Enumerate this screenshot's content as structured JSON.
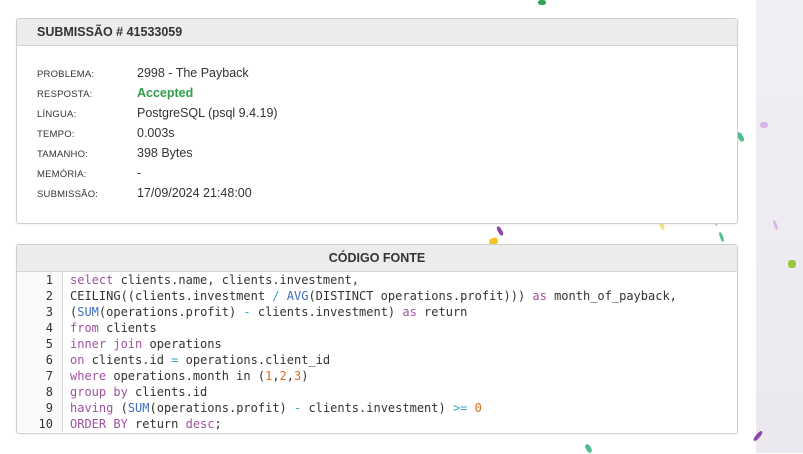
{
  "submission": {
    "title": "SUBMISSÃO # 41533059",
    "rows": [
      {
        "label": "PROBLEMA:",
        "value": "2998 - The Payback"
      },
      {
        "label": "RESPOSTA:",
        "value": "Accepted"
      },
      {
        "label": "LÍNGUA:",
        "value": "PostgreSQL (psql 9.4.19)"
      },
      {
        "label": "TEMPO:",
        "value": "0.003s"
      },
      {
        "label": "TAMANHO:",
        "value": "398 Bytes"
      },
      {
        "label": "MEMÓRIA:",
        "value": "-"
      },
      {
        "label": "SUBMISSÃO:",
        "value": "17/09/2024 21:48:00"
      }
    ],
    "status_color": "#2e9e4a"
  },
  "code": {
    "title": "CÓDIGO FONTE",
    "line_numbers": [
      "1",
      "2",
      "3",
      "4",
      "5",
      "6",
      "7",
      "8",
      "9",
      "10"
    ],
    "lines": [
      [
        [
          "kw",
          "select"
        ],
        [
          "",
          "  clients.name, clients.investment,"
        ]
      ],
      [
        [
          "",
          "CEILING((clients.investment "
        ],
        [
          "op",
          "/"
        ],
        [
          "",
          ""
        ],
        [
          "fn",
          " AVG"
        ],
        [
          "",
          "(DISTINCT operations.profit))) "
        ],
        [
          "kw",
          "as"
        ],
        [
          "",
          ""
        ],
        [
          "",
          "  month_of_payback,"
        ]
      ],
      [
        [
          "",
          "("
        ],
        [
          "fn",
          "SUM"
        ],
        [
          "",
          "(operations.profit) "
        ],
        [
          "op",
          "-"
        ],
        [
          "",
          ""
        ],
        [
          "",
          "  clients.investment) "
        ],
        [
          "kw",
          "as"
        ],
        [
          "",
          ""
        ],
        [
          "",
          "  return"
        ]
      ],
      [
        [
          "kw",
          "from"
        ],
        [
          "",
          ""
        ],
        [
          "",
          "  clients"
        ]
      ],
      [
        [
          "kw",
          "inner join"
        ],
        [
          "",
          ""
        ],
        [
          "",
          "  operations"
        ]
      ],
      [
        [
          "kw",
          "on"
        ],
        [
          "",
          ""
        ],
        [
          "",
          "  clients.id "
        ],
        [
          "op",
          "="
        ],
        [
          "",
          ""
        ],
        [
          "",
          "  operations.client_id"
        ]
      ],
      [
        [
          "kw",
          "where"
        ],
        [
          "",
          ""
        ],
        [
          "",
          "  operations.month in ("
        ],
        [
          "num",
          "1"
        ],
        [
          "",
          ","
        ],
        [
          "num",
          "2"
        ],
        [
          "",
          ","
        ],
        [
          "num",
          "3"
        ],
        [
          "",
          ")"
        ]
      ],
      [
        [
          "kw",
          "group by"
        ],
        [
          "",
          ""
        ],
        [
          "",
          "  clients.id"
        ]
      ],
      [
        [
          "kw",
          "having"
        ],
        [
          "",
          ""
        ],
        [
          "",
          "  ("
        ],
        [
          "fn",
          "SUM"
        ],
        [
          "",
          "(operations.profit) "
        ],
        [
          "op",
          "-"
        ],
        [
          "",
          ""
        ],
        [
          "",
          "  clients.investment) "
        ],
        [
          "op",
          ">="
        ],
        [
          "",
          ""
        ],
        [
          "num",
          " 0"
        ]
      ],
      [
        [
          "kw",
          "ORDER BY"
        ],
        [
          "",
          ""
        ],
        [
          "",
          "  return "
        ],
        [
          "kw",
          "desc"
        ],
        [
          "",
          ";"
        ]
      ]
    ]
  }
}
